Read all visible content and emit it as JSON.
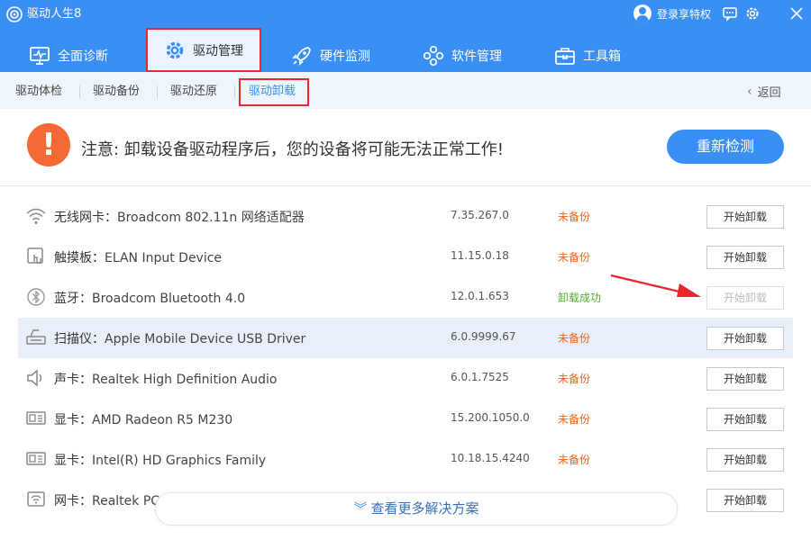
{
  "app": {
    "title": "驱动人生8"
  },
  "topbar": {
    "login_text": "登录享特权"
  },
  "main_tabs": [
    {
      "label": "全面诊断"
    },
    {
      "label": "驱动管理"
    },
    {
      "label": "硬件监测"
    },
    {
      "label": "软件管理"
    },
    {
      "label": "工具箱"
    }
  ],
  "sub_tabs": [
    {
      "label": "驱动体检"
    },
    {
      "label": "驱动备份"
    },
    {
      "label": "驱动还原"
    },
    {
      "label": "驱动卸载"
    }
  ],
  "back_label": "返回",
  "warning": {
    "text": "注意: 卸载设备驱动程序后，您的设备将可能无法正常工作!",
    "button": "重新检测"
  },
  "drivers": [
    {
      "type": "无线网卡：",
      "name": "Broadcom 802.11n 网络适配器",
      "version": "7.35.267.0",
      "status": "未备份",
      "button": "开始卸载",
      "icon": "wifi-icon"
    },
    {
      "type": "触摸板：",
      "name": "ELAN Input Device",
      "version": "11.15.0.18",
      "status": "未备份",
      "button": "开始卸载",
      "icon": "touchpad-icon"
    },
    {
      "type": "蓝牙：",
      "name": "Broadcom Bluetooth 4.0",
      "version": "12.0.1.653",
      "status": "卸载成功",
      "button": "开始卸载",
      "icon": "bluetooth-icon"
    },
    {
      "type": "扫描仪：",
      "name": "Apple Mobile Device USB Driver",
      "version": "6.0.9999.67",
      "status": "未备份",
      "button": "开始卸载",
      "icon": "scanner-icon"
    },
    {
      "type": "声卡：",
      "name": "Realtek High Definition Audio",
      "version": "6.0.1.7525",
      "status": "未备份",
      "button": "开始卸载",
      "icon": "speaker-icon"
    },
    {
      "type": "显卡：",
      "name": "AMD Radeon R5 M230",
      "version": "15.200.1050.0",
      "status": "未备份",
      "button": "开始卸载",
      "icon": "graphics-card-icon"
    },
    {
      "type": "显卡：",
      "name": "Intel(R) HD Graphics Family",
      "version": "10.18.15.4240",
      "status": "未备份",
      "button": "开始卸载",
      "icon": "graphics-card-icon"
    },
    {
      "type": "网卡：",
      "name": "Realtek PC",
      "version": "",
      "status": "",
      "button": "开始卸载",
      "icon": "network-card-icon"
    }
  ],
  "more_label": "查看更多解决方案",
  "colors": {
    "brand": "#3a8ff5",
    "warning": "#f36a35",
    "pending": "#f0641e",
    "success": "#52b030",
    "highlight_border": "#e8272f"
  }
}
